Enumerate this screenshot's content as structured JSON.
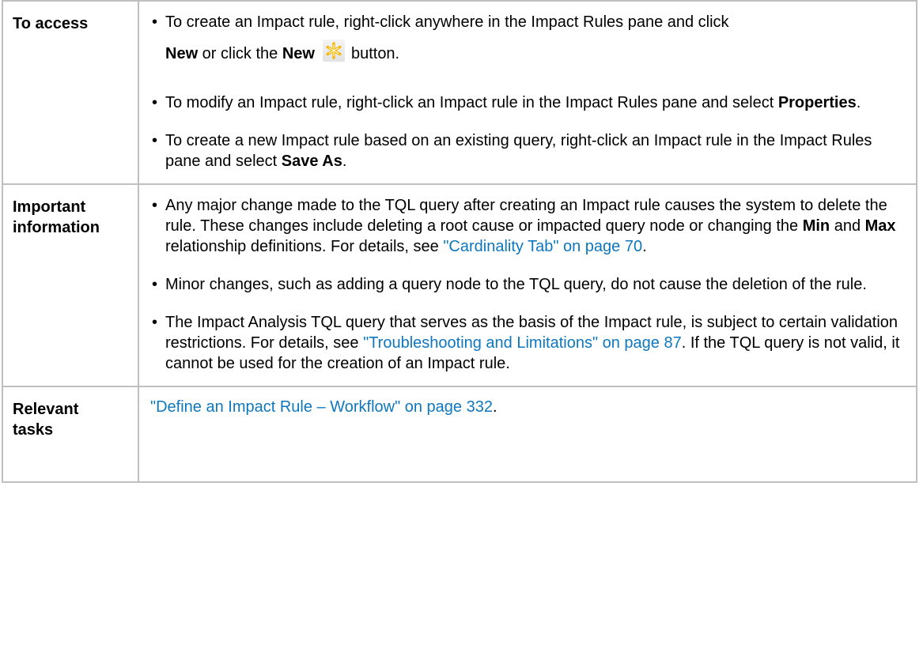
{
  "rows": {
    "access": {
      "label": "To access",
      "item1": {
        "text_a": "To create an Impact rule, right-click anywhere in the Impact Rules pane and click",
        "bold_new1": "New",
        "text_or": " or click the ",
        "bold_new2": "New",
        "icon": "new-star-icon",
        "text_button": "button."
      },
      "item2": {
        "text_a": "To modify an Impact rule, right-click an Impact rule in the Impact Rules pane and select ",
        "bold": "Properties",
        "text_end": "."
      },
      "item3": {
        "text_a": "To create a new Impact rule based on an existing query, right-click an Impact rule in the Impact Rules pane and select ",
        "bold": "Save As",
        "text_end": "."
      }
    },
    "important": {
      "label_line1": "Important",
      "label_line2": "information",
      "item1": {
        "text_a": "Any major change made to the TQL query after creating an Impact rule causes the system to delete the rule. These changes include deleting a root cause or impacted query node or changing the ",
        "bold_min": "Min",
        "text_and": " and ",
        "bold_max": "Max",
        "text_b": " relationship definitions. For details, see ",
        "link": "\"Cardinality Tab\" on page 70",
        "text_end": "."
      },
      "item2": {
        "text": "Minor changes, such as adding a query node to the TQL query, do not cause the deletion of the rule."
      },
      "item3": {
        "text_a": "The Impact Analysis TQL query that serves as the basis of the Impact rule, is subject to certain validation restrictions. For details, see ",
        "link": "\"Troubleshooting and Limitations\" on page 87",
        "text_b": ". If the TQL query is not valid, it cannot be used for the creation of an Impact rule."
      }
    },
    "tasks": {
      "label_line1": "Relevant",
      "label_line2": "tasks",
      "link": "\"Define an Impact Rule – Workflow\" on page 332",
      "text_end": "."
    }
  },
  "colors": {
    "link": "#0e77bd",
    "border": "#bfbfbf",
    "star": "#f2b705"
  }
}
